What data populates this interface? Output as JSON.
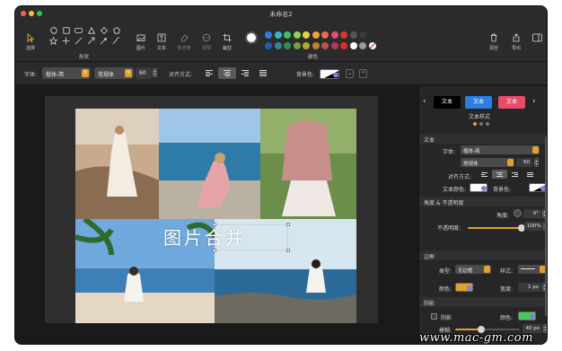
{
  "window": {
    "title": "未命名2"
  },
  "toolbar": {
    "select_label": "选择",
    "shapes_label": "形状",
    "image_label": "图片",
    "text_label": "文本",
    "eraser_label": "橡皮擦",
    "transparent_label": "透明",
    "crop_label": "裁剪",
    "colors_label": "颜色",
    "clear_label": "清空",
    "export_label": "导出"
  },
  "palette": {
    "selected_color": "#ffffff",
    "row1": [
      "#2f7de1",
      "#38b6c9",
      "#3fbf6b",
      "#8fd14f",
      "#e3d446",
      "#f0a43a",
      "#ef6b4c",
      "#e84b6c",
      "#d9372d",
      "#555555",
      "#3a3a3a"
    ],
    "row2": [
      "#1e5fb3",
      "#2a8a98",
      "#2e8f51",
      "#6ea13c",
      "#b7a833",
      "#c17f2a",
      "#c0513a",
      "#b83653",
      "#e02b2b",
      "#ffffff",
      "#9a9a9a",
      "#f5f5f5"
    ]
  },
  "formatbar": {
    "font_label": "字体:",
    "font_family": "楷体-简",
    "font_weight": "常规体",
    "font_size": "60",
    "align_label": "对齐方式:",
    "bg_label": "背景色:"
  },
  "canvas": {
    "overlay_text": "图片合并"
  },
  "panel": {
    "text_style_label": "文本样式",
    "style_chip_1": "文本",
    "style_chip_2": "文本",
    "style_chip_3": "文本",
    "section_text": "文本",
    "font_label": "字体:",
    "font_family": "楷体-简",
    "font_weight": "常规体",
    "font_size": "60",
    "align_label": "对齐方式:",
    "text_color_label": "文本颜色:",
    "bg_color_label": "背景色:",
    "section_angle": "角度 & 不透明度",
    "angle_label": "角度:",
    "angle_value": "0°",
    "opacity_label": "不透明度:",
    "opacity_value": "100%",
    "opacity_fraction": 1.0,
    "section_border": "边框",
    "type_label": "类型:",
    "type_value": "无边框",
    "style_label": "样式:",
    "color_label": "颜色:",
    "width_label": "宽度:",
    "width_value": "1 px",
    "section_shadow": "阴影",
    "shadow_label": "阴影",
    "shadow_color_label": "颜色:",
    "blur_label": "模糊:",
    "blur_value": "40 px",
    "blur_fraction": 0.4
  },
  "watermark": "www.mac-gm.com"
}
